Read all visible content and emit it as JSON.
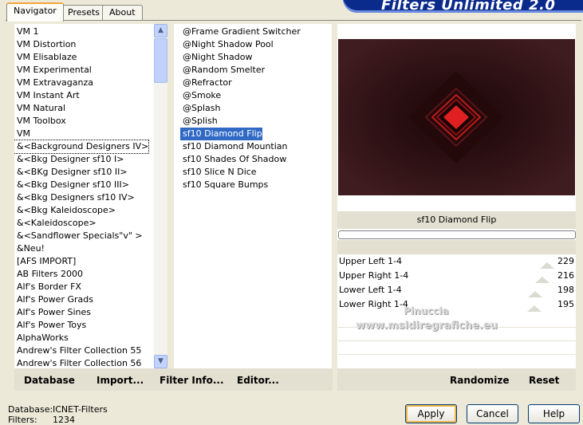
{
  "header": {
    "title": "Filters Unlimited 2.0"
  },
  "tabs": [
    {
      "label": "Navigator"
    },
    {
      "label": "Presets"
    },
    {
      "label": "About"
    }
  ],
  "categories": [
    "VM 1",
    "VM Distortion",
    "VM Elisablaze",
    "VM Experimental",
    "VM Extravaganza",
    "VM Instant Art",
    "VM Natural",
    "VM Toolbox",
    "VM",
    "&<Background Designers IV>",
    "&<Bkg Designer sf10 I>",
    "&<BKg Designer sf10 II>",
    "&<Bkg Designer sf10 III>",
    "&<Bkg Designers sf10 IV>",
    "&<Bkg Kaleidoscope>",
    "&<Kaleidoscope>",
    "&<Sandflower Specials\"v\" >",
    "&Neu!",
    "[AFS IMPORT]",
    "AB Filters 2000",
    "Alf's Border FX",
    "Alf's Power Grads",
    "Alf's Power Sines",
    "Alf's Power Toys",
    "AlphaWorks",
    "Andrew's Filter Collection 55",
    "Andrew's Filter Collection 56"
  ],
  "filters": [
    "@Frame Gradient Switcher",
    "@Night Shadow Pool",
    "@Night Shadow",
    "@Random Smelter",
    "@Refractor",
    "@Smoke",
    "@Splash",
    "@Splish",
    "sf10 Diamond Flip",
    "sf10 Diamond Mountian",
    "sf10 Shades Of Shadow",
    "sf10 Slice N Dice",
    "sf10 Square Bumps"
  ],
  "selected_filter_index": 8,
  "preview": {
    "filter_name": "sf10 Diamond Flip"
  },
  "sliders": [
    {
      "label": "Upper Left 1-4",
      "value": "229",
      "level": 229
    },
    {
      "label": "Upper Right 1-4",
      "value": "216",
      "level": 216
    },
    {
      "label": "Lower Left 1-4",
      "value": "198",
      "level": 198
    },
    {
      "label": "Lower Right 1-4",
      "value": "195",
      "level": 195
    }
  ],
  "toolbar": {
    "database": "Database",
    "import": "Import...",
    "filter_info": "Filter Info...",
    "editor": "Editor...",
    "randomize": "Randomize",
    "reset": "Reset"
  },
  "status": {
    "database_label": "Database:",
    "database_value": "ICNET-Filters",
    "filters_label": "Filters:",
    "filters_value": "1234"
  },
  "buttons": {
    "apply": "Apply",
    "cancel": "Cancel",
    "help": "Help"
  },
  "watermark": {
    "line1": "Pinuccia",
    "line2": "www.msldiregrafiche.eu"
  },
  "colors": {
    "selection": "#316ac5",
    "banner": "#0a2a8c",
    "diamond": "#e02020"
  }
}
